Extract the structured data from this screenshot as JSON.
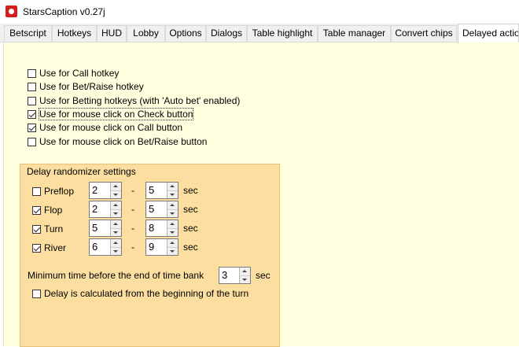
{
  "window": {
    "title": "StarsCaption v0.27j"
  },
  "tabs": [
    "Betscript",
    "Hotkeys",
    "HUD",
    "Lobby",
    "Options",
    "Dialogs",
    "Table highlight",
    "Table manager",
    "Convert chips",
    "Delayed actio"
  ],
  "options": [
    {
      "label": "Use for Call hotkey",
      "checked": false
    },
    {
      "label": "Use for Bet/Raise hotkey",
      "checked": false
    },
    {
      "label": "Use for Betting hotkeys (with 'Auto bet' enabled)",
      "checked": false
    },
    {
      "label": "Use for mouse click on Check button",
      "checked": true
    },
    {
      "label": "Use for mouse click on Call button",
      "checked": true
    },
    {
      "label": "Use for mouse click on Bet/Raise button",
      "checked": false
    }
  ],
  "randomizer": {
    "title": "Delay randomizer settings",
    "dash": "-",
    "unit": "sec",
    "streets": [
      {
        "label": "Preflop",
        "checked": false,
        "min": "2",
        "max": "5"
      },
      {
        "label": "Flop",
        "checked": true,
        "min": "2",
        "max": "5"
      },
      {
        "label": "Turn",
        "checked": true,
        "min": "5",
        "max": "8"
      },
      {
        "label": "River",
        "checked": true,
        "min": "6",
        "max": "9"
      }
    ],
    "min_time_label": "Minimum time before the end of time bank",
    "min_time_value": "3",
    "min_time_unit": "sec",
    "from_beginning_label": "Delay is calculated from the beginning of the turn",
    "from_beginning_checked": false
  }
}
